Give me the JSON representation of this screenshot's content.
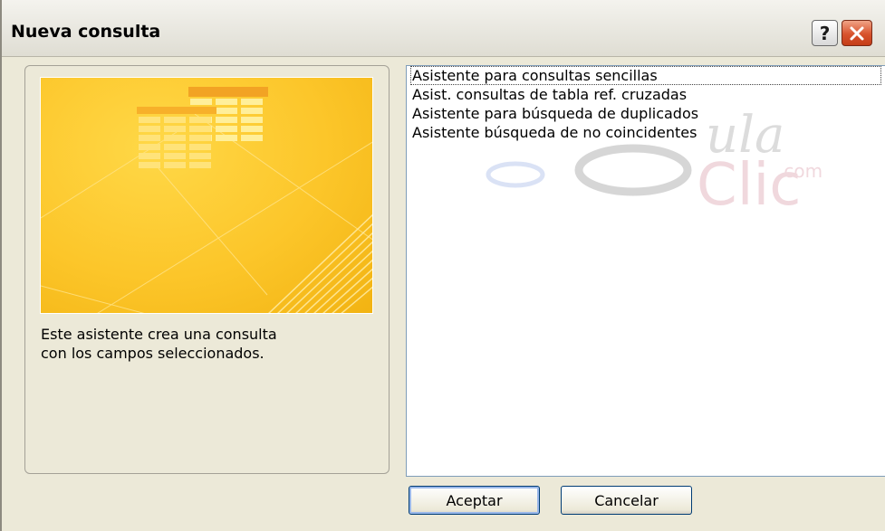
{
  "window": {
    "title": "Nueva consulta",
    "help_glyph": "?"
  },
  "description": "Este asistente crea una consulta\ncon los campos seleccionados.",
  "wizard_list": {
    "items": [
      "Asistente para consultas sencillas",
      "Asist. consultas de tabla ref. cruzadas",
      "Asistente para búsqueda de duplicados",
      "Asistente búsqueda de no coincidentes"
    ],
    "selected_index": 0
  },
  "watermark_text": {
    "top": "ula",
    "com": ".com",
    "bottom": "Clic"
  },
  "buttons": {
    "ok_label": "Aceptar",
    "cancel_label": "Cancelar"
  },
  "colors": {
    "dialog_bg": "#ece9d8",
    "preview_yellow": "#fcc62a",
    "close_red": "#d8532d"
  },
  "icons": {
    "help": "help-icon",
    "close": "close-icon",
    "preview": "query-wizard-illustration"
  }
}
